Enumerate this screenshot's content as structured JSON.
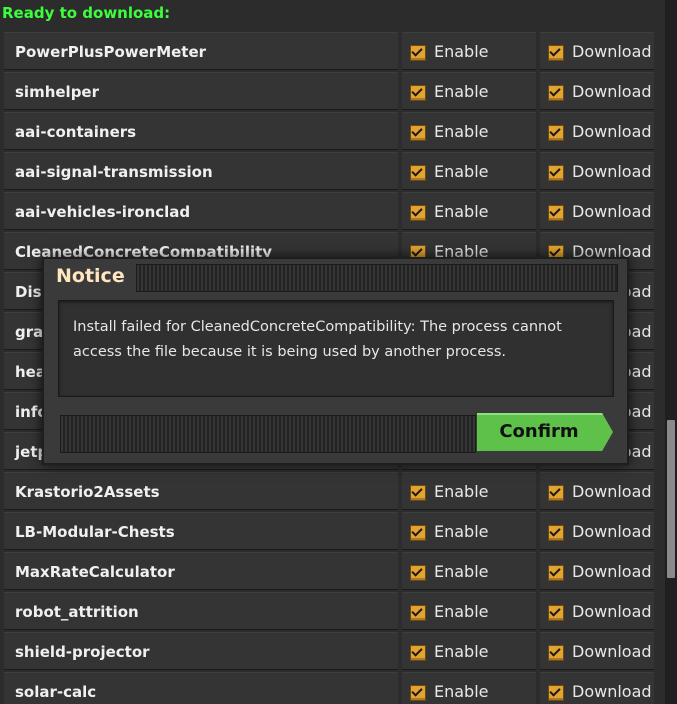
{
  "header": {
    "title": "Ready to download:"
  },
  "columns": {
    "enable_label": "Enable",
    "download_label": "Download"
  },
  "mods": [
    {
      "name": "PowerPlusPowerMeter",
      "enable": true,
      "download": true
    },
    {
      "name": "simhelper",
      "enable": true,
      "download": true
    },
    {
      "name": "aai-containers",
      "enable": true,
      "download": true
    },
    {
      "name": "aai-signal-transmission",
      "enable": true,
      "download": true
    },
    {
      "name": "aai-vehicles-ironclad",
      "enable": true,
      "download": true
    },
    {
      "name": "CleanedConcreteCompatibility",
      "enable": true,
      "download": true
    },
    {
      "name": "Disp",
      "enable": true,
      "download": true
    },
    {
      "name": "grap",
      "enable": true,
      "download": true
    },
    {
      "name": "hea",
      "enable": true,
      "download": true
    },
    {
      "name": "info",
      "enable": true,
      "download": true
    },
    {
      "name": "jetp",
      "enable": true,
      "download": true
    },
    {
      "name": "Krastorio2Assets",
      "enable": true,
      "download": true
    },
    {
      "name": "LB-Modular-Chests",
      "enable": true,
      "download": true
    },
    {
      "name": "MaxRateCalculator",
      "enable": true,
      "download": true
    },
    {
      "name": "robot_attrition",
      "enable": true,
      "download": true
    },
    {
      "name": "shield-projector",
      "enable": true,
      "download": true
    },
    {
      "name": "solar-calc",
      "enable": true,
      "download": true
    }
  ],
  "dialog": {
    "title": "Notice",
    "message": "Install failed for CleanedConcreteCompatibility: The process cannot access the file because it is being used by another process.",
    "confirm_label": "Confirm"
  },
  "colors": {
    "header_text": "#3cff3c",
    "checkbox": "#e2a42e",
    "confirm_button": "#5ec24a",
    "dialog_title": "#ffe6c0"
  }
}
